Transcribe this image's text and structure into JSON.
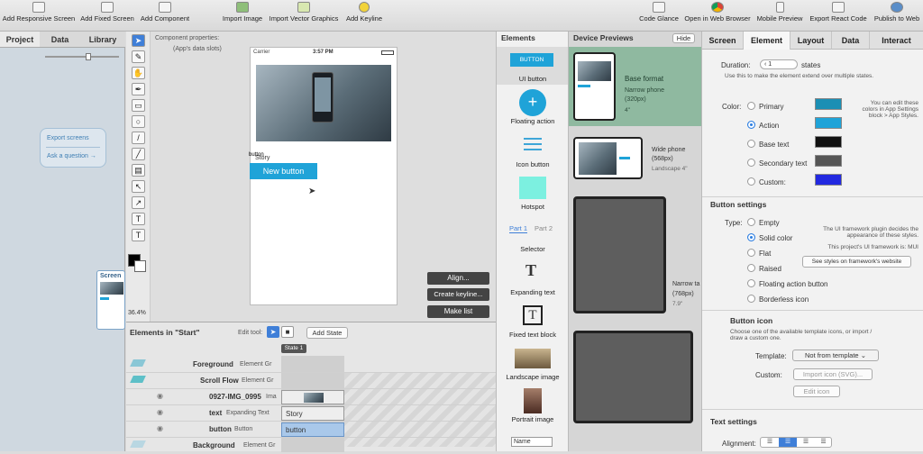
{
  "toolbar": {
    "left": [
      "Add Responsive Screen",
      "Add Fixed Screen",
      "Add Component",
      "Import Image",
      "Import Vector Graphics",
      "Add Keyline"
    ],
    "right": [
      "Code Glance",
      "Open in Web Browser",
      "Mobile Preview",
      "Export React Code",
      "Publish to Web"
    ]
  },
  "left_panel": {
    "tabs": [
      "Project",
      "Data",
      "Library"
    ],
    "menu": [
      "Export screens",
      "Ask a question →"
    ],
    "screen_thumb_label": "Screen"
  },
  "canvas": {
    "component_props": "Component properties:",
    "app_slots": "(App's data slots)",
    "zoom": "36.4%",
    "phone_carrier": "Carrier",
    "phone_time": "3:57 PM",
    "story_text": "Story",
    "button_tag": "button",
    "new_button": "New button",
    "align_btn": "Align...",
    "keyline_btn": "Create keyline...",
    "makelist_btn": "Make list"
  },
  "bottom": {
    "title": "Elements in \"Start\"",
    "edit_tool": "Edit tool:",
    "add_state": "Add State",
    "state1": "State 1",
    "rows": [
      {
        "name": "Foreground",
        "type": "Element Gr"
      },
      {
        "name": "Scroll Flow",
        "type": "Element Gr"
      },
      {
        "name": "0927-IMG_0995",
        "type": "Ima"
      },
      {
        "name": "text",
        "type": "Expanding Text"
      },
      {
        "name": "button",
        "type": "Button"
      },
      {
        "name": "Background",
        "type": "Element Gr"
      }
    ],
    "story_cell": "Story",
    "button_cell": "button"
  },
  "elements_panel": {
    "title": "Elements",
    "button_chip": "BUTTON",
    "items": [
      "UI button",
      "Floating action",
      "Icon button",
      "Hotspot",
      "Selector",
      "Expanding text",
      "Fixed text block",
      "Landscape image",
      "Portrait image"
    ],
    "part1": "Part 1",
    "part2": "Part 2",
    "name_field": "Name"
  },
  "previews": {
    "title": "Device Previews",
    "hide": "Hide",
    "base_format": "Base format",
    "narrow_phone": "Narrow phone",
    "narrow_phone_px": "(320px)",
    "narrow_phone_size": "4\"",
    "wide_phone": "Wide phone",
    "wide_phone_px": "(568px)",
    "wide_phone_size": "Landscape 4\"",
    "narrow_tablet": "Narrow ta",
    "narrow_tablet_px": "(768px)",
    "narrow_tablet_size": "7.9\""
  },
  "right_panel": {
    "tabs": [
      "Screen",
      "Element",
      "Layout",
      "Data",
      "Interact"
    ],
    "duration_label": "Duration:",
    "duration_value": "1",
    "duration_unit": "states",
    "duration_hint": "Use this to make the element extend over multiple states.",
    "color_label": "Color:",
    "colors": [
      {
        "label": "Primary",
        "swatch": "#1b8fb4"
      },
      {
        "label": "Action",
        "swatch": "#1fa3d8"
      },
      {
        "label": "Base text",
        "swatch": "#111111"
      },
      {
        "label": "Secondary text",
        "swatch": "#555555"
      },
      {
        "label": "Custom:",
        "swatch": "#2229e0"
      }
    ],
    "color_hint": "You can edit these colors in App Settings block > App Styles.",
    "button_settings": "Button settings",
    "type_label": "Type:",
    "types": [
      "Empty",
      "Solid color",
      "Flat",
      "Raised",
      "Floating action button",
      "Borderless icon"
    ],
    "framework_hint": "The UI framework plugin decides the appearance of these styles.",
    "framework_is": "This project's UI framework is: MUI",
    "see_styles": "See styles on framework's website",
    "button_icon": "Button icon",
    "icon_hint": "Choose one of the available template icons, or import / draw a custom one.",
    "template_label": "Template:",
    "template_value": "Not from template",
    "custom_label": "Custom:",
    "import_icon": "Import icon (SVG)...",
    "edit_icon": "Edit icon",
    "text_settings": "Text settings",
    "alignment_label": "Alignment:"
  }
}
